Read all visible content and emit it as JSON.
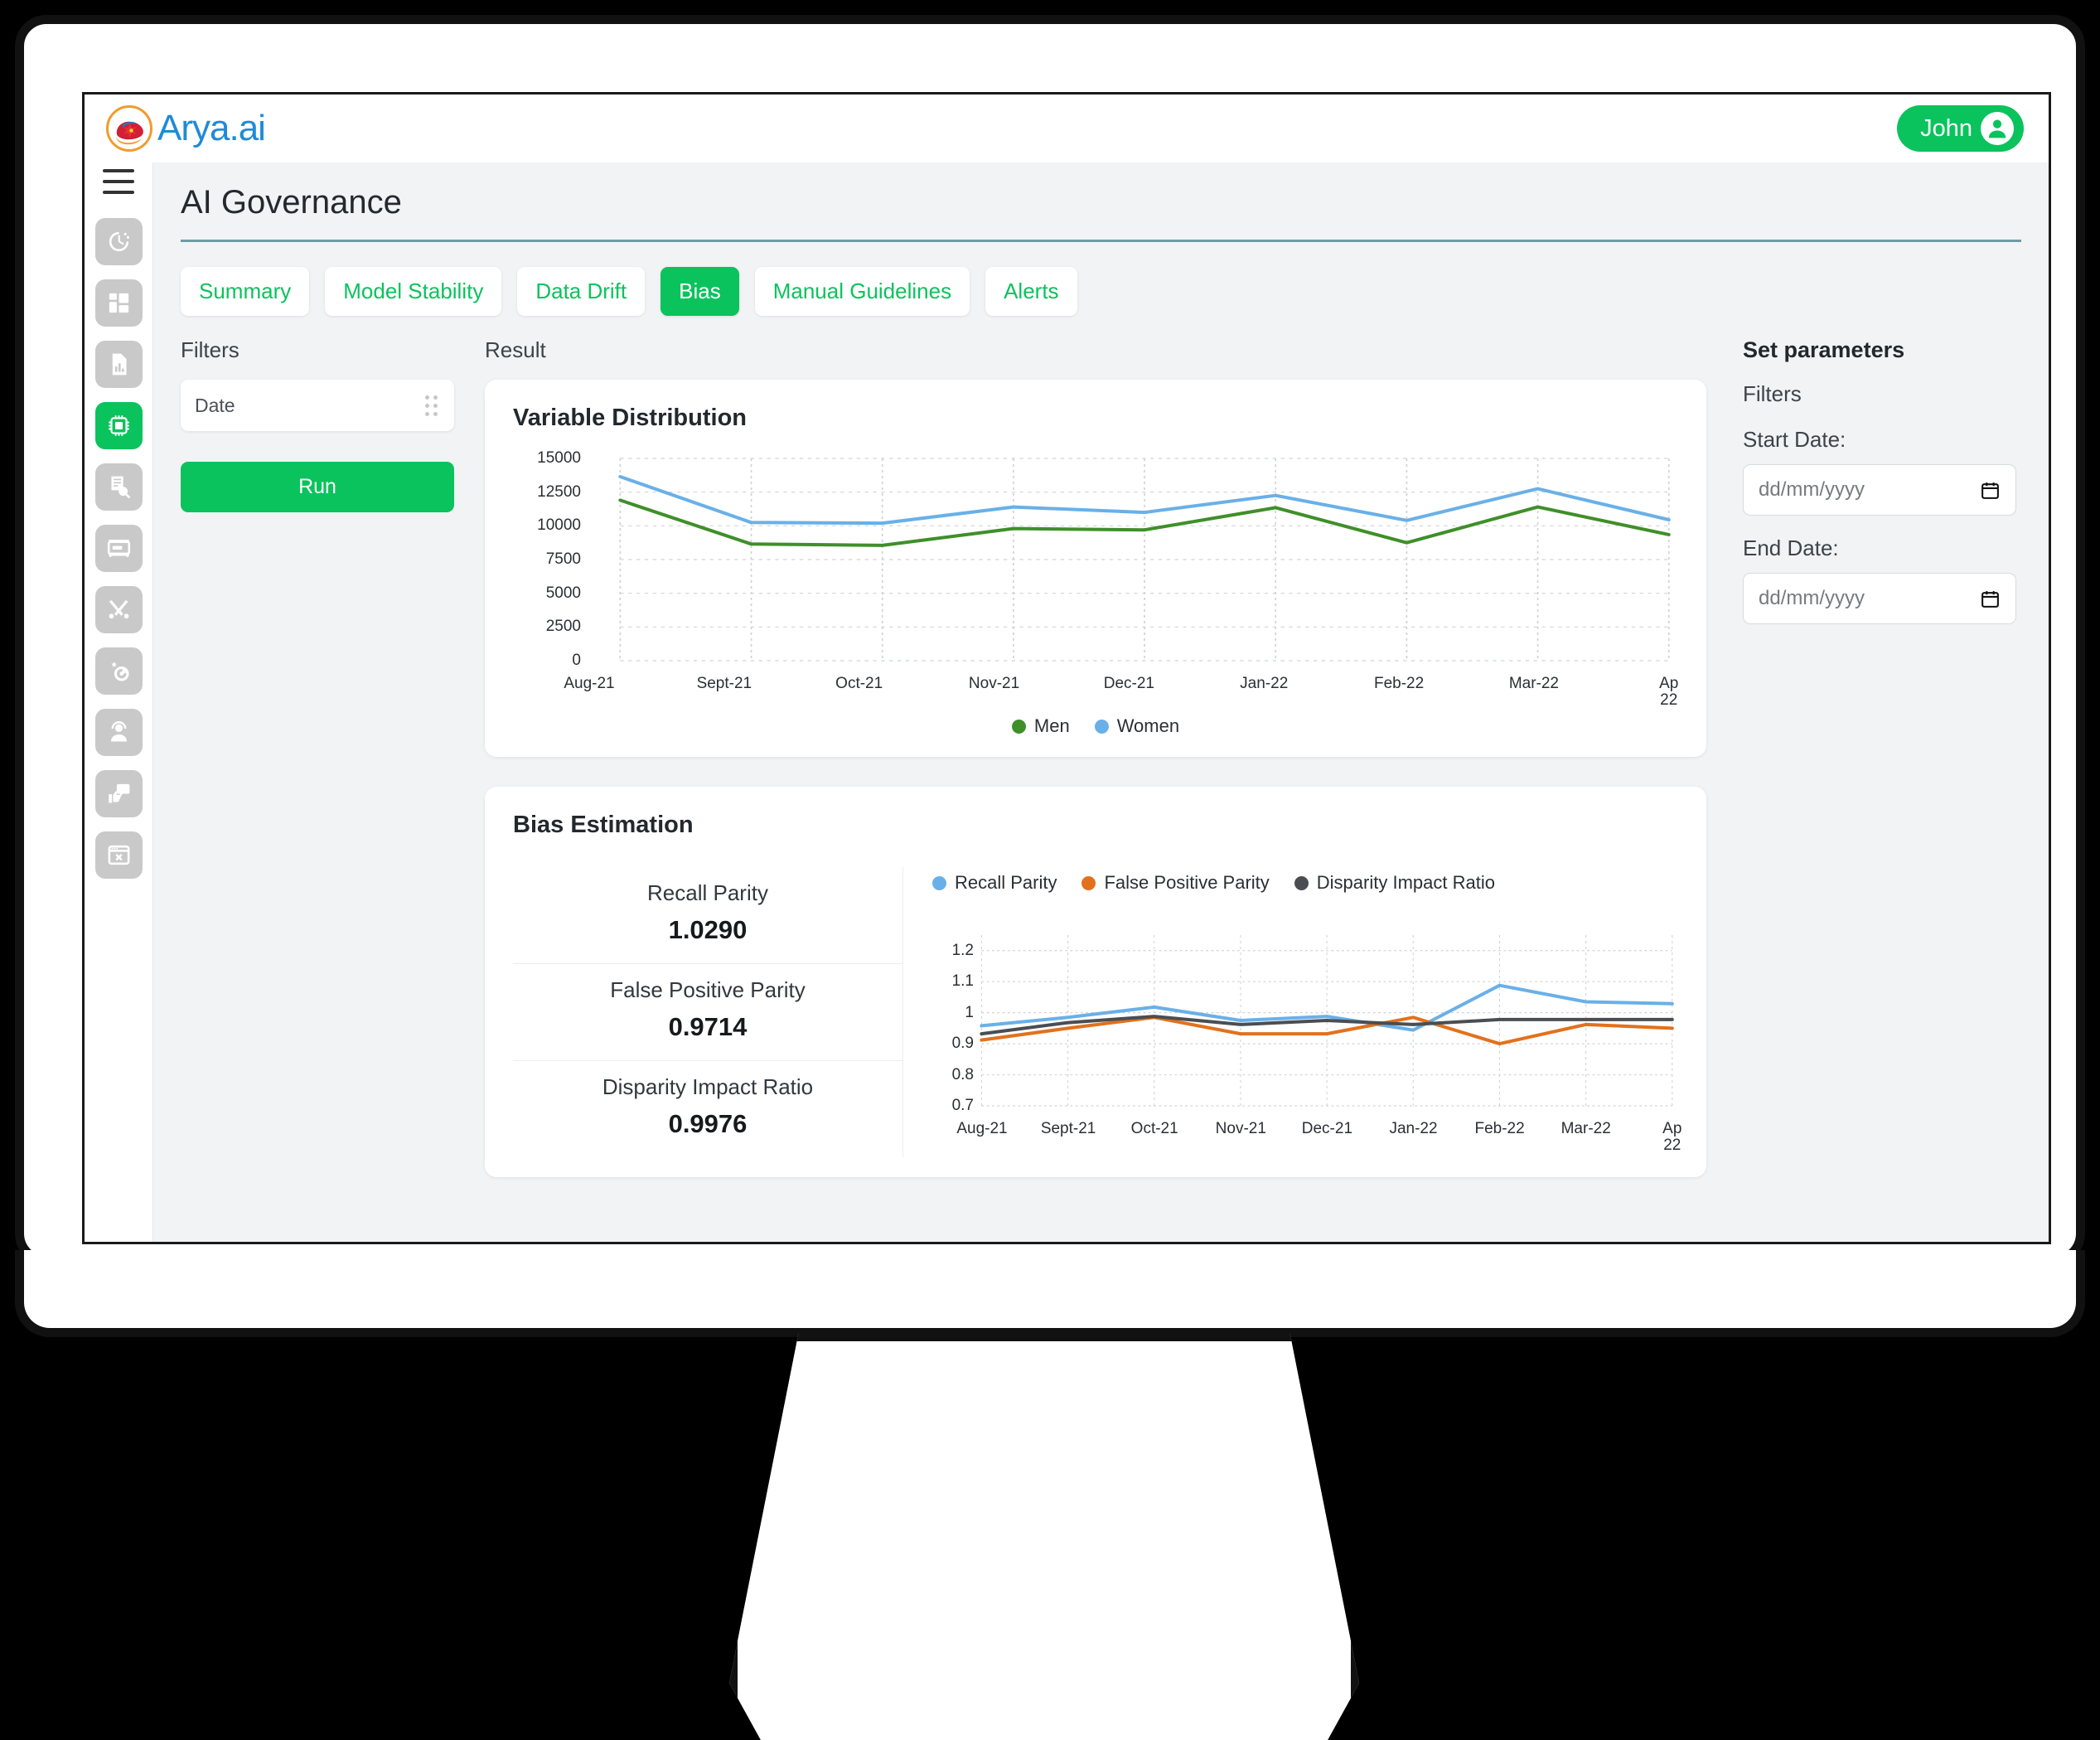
{
  "brand": {
    "name": "Arya.ai",
    "logo_icon": "brain-logo-icon"
  },
  "user": {
    "name": "John",
    "avatar_icon": "user-avatar-icon"
  },
  "sidebar": {
    "menu_icon": "hamburger-icon",
    "items": [
      {
        "icon": "clock-history-icon",
        "active": false
      },
      {
        "icon": "dashboard-grid-icon",
        "active": false
      },
      {
        "icon": "report-document-icon",
        "active": false
      },
      {
        "icon": "ai-chip-icon",
        "active": true
      },
      {
        "icon": "policy-search-icon",
        "active": false
      },
      {
        "icon": "server-rack-icon",
        "active": false
      },
      {
        "icon": "tools-wrench-icon",
        "active": false
      },
      {
        "icon": "settings-gears-icon",
        "active": false
      },
      {
        "icon": "support-agent-icon",
        "active": false
      },
      {
        "icon": "feedback-thumbsup-icon",
        "active": false
      },
      {
        "icon": "browser-close-icon",
        "active": false
      }
    ]
  },
  "page": {
    "title": "AI Governance"
  },
  "tabs": [
    {
      "label": "Summary",
      "active": false
    },
    {
      "label": "Model Stability",
      "active": false
    },
    {
      "label": "Data Drift",
      "active": false
    },
    {
      "label": "Bias",
      "active": true
    },
    {
      "label": "Manual Guidelines",
      "active": false
    },
    {
      "label": "Alerts",
      "active": false
    }
  ],
  "filters": {
    "heading": "Filters",
    "select_value": "Date",
    "grip_icon": "drag-grip-icon",
    "run_label": "Run"
  },
  "result": {
    "heading": "Result",
    "variable_distribution": {
      "title": "Variable Distribution"
    },
    "bias_estimation": {
      "title": "Bias Estimation",
      "metrics": [
        {
          "name": "Recall Parity",
          "value": "1.0290"
        },
        {
          "name": "False Positive Parity",
          "value": "0.9714"
        },
        {
          "name": "Disparity Impact Ratio",
          "value": "0.9976"
        }
      ]
    }
  },
  "parameters": {
    "title": "Set parameters",
    "filters_label": "Filters",
    "start_date": {
      "label": "Start Date:",
      "placeholder": "dd/mm/yyyy",
      "value": "",
      "icon": "calendar-icon"
    },
    "end_date": {
      "label": "End Date:",
      "placeholder": "dd/mm/yyyy",
      "value": "",
      "icon": "calendar-icon"
    }
  },
  "colors": {
    "brand_green": "#0ac35c",
    "brand_blue": "#1f8bd6",
    "men_green": "#3f8f29",
    "women_blue": "#69b0e8",
    "recall_blue": "#69b0e8",
    "fpp_orange": "#e2711d",
    "dir_gray": "#4a4e52",
    "title_rule": "#6f9ba3"
  },
  "chart_data": [
    {
      "type": "line",
      "title": "Variable Distribution",
      "xlabel": "",
      "ylabel": "",
      "grid": true,
      "legend_position": "bottom",
      "categories": [
        "Aug-21",
        "Sept-21",
        "Oct-21",
        "Nov-21",
        "Dec-21",
        "Jan-22",
        "Feb-22",
        "Mar-22",
        "Apr-22"
      ],
      "x_tick_labels": [
        "Aug-21",
        "Sept-21",
        "Oct-21",
        "Nov-21",
        "Dec-21",
        "Jan-22",
        "Feb-22",
        "Mar-22",
        "Ap\n22"
      ],
      "y_tick_labels": [
        "15000",
        "12500",
        "10000",
        "7500",
        "5000",
        "2500",
        "0"
      ],
      "ylim": [
        0,
        15000
      ],
      "series": [
        {
          "name": "Men",
          "color": "#3f8f29",
          "values": [
            11900,
            8650,
            8550,
            9800,
            9700,
            11350,
            8750,
            11400,
            9350
          ]
        },
        {
          "name": "Women",
          "color": "#69b0e8",
          "values": [
            13650,
            10250,
            10200,
            11400,
            11000,
            12250,
            10400,
            12750,
            10450
          ]
        }
      ]
    },
    {
      "type": "line",
      "title": "Bias Estimation",
      "xlabel": "",
      "ylabel": "",
      "grid": true,
      "legend_position": "top",
      "categories": [
        "Aug-21",
        "Sept-21",
        "Oct-21",
        "Nov-21",
        "Dec-21",
        "Jan-22",
        "Feb-22",
        "Mar-22",
        "Apr-22"
      ],
      "x_tick_labels": [
        "Aug-21",
        "Sept-21",
        "Oct-21",
        "Nov-21",
        "Dec-21",
        "Jan-22",
        "Feb-22",
        "Mar-22",
        "Ap\n22"
      ],
      "y_tick_labels": [
        "1.2",
        "1.1",
        "1",
        "0.9",
        "0.8",
        "0.7"
      ],
      "ylim": [
        0.7,
        1.25
      ],
      "series": [
        {
          "name": "Recall Parity",
          "color": "#69b0e8",
          "values": [
            0.958,
            0.985,
            1.018,
            0.975,
            0.988,
            0.944,
            1.088,
            1.035,
            1.029
          ]
        },
        {
          "name": "False Positive Parity",
          "color": "#e2711d",
          "values": [
            0.912,
            0.95,
            0.985,
            0.932,
            0.932,
            0.985,
            0.9,
            0.962,
            0.95
          ]
        },
        {
          "name": "Disparity Impact Ratio",
          "color": "#4a4e52",
          "values": [
            0.932,
            0.968,
            0.988,
            0.962,
            0.975,
            0.962,
            0.978,
            0.978,
            0.978
          ]
        }
      ]
    }
  ]
}
